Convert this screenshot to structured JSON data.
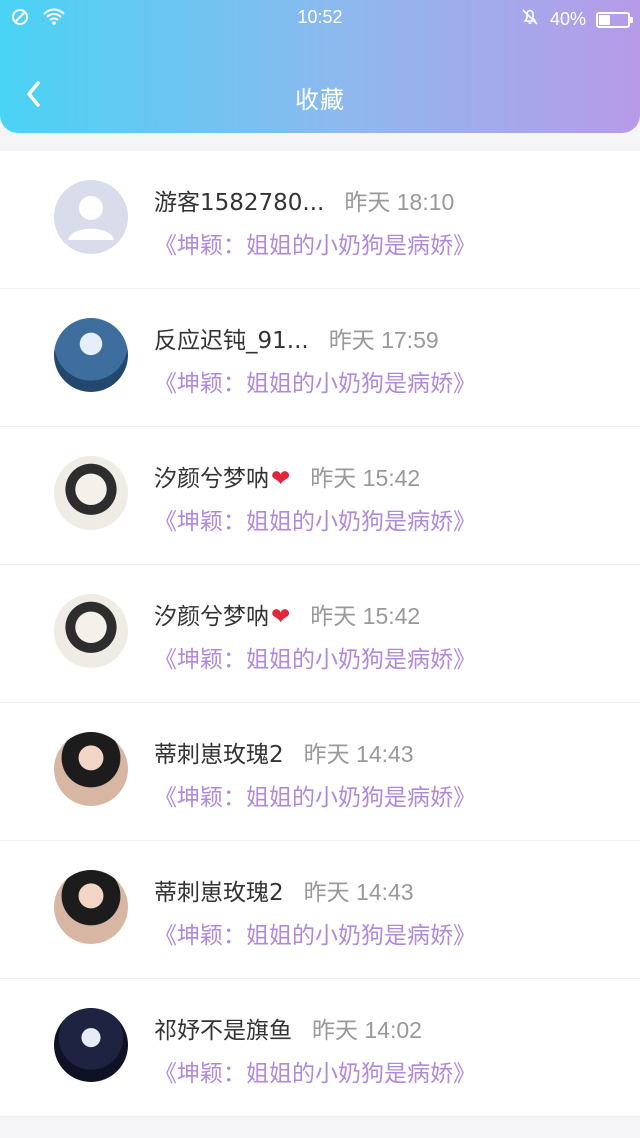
{
  "status_bar": {
    "time": "10:52",
    "battery_percent": "40%",
    "battery_level": 0.4
  },
  "header": {
    "title": "收藏",
    "back_icon": "chevron-left-icon"
  },
  "items": [
    {
      "username": "游客1582780...",
      "time": "昨天 18:10",
      "book_title": "《坤颖：姐姐的小奶狗是病娇》",
      "has_heart": false
    },
    {
      "username": "反应迟钝_91...",
      "time": "昨天 17:59",
      "book_title": "《坤颖：姐姐的小奶狗是病娇》",
      "has_heart": false
    },
    {
      "username": "汐颜兮梦呐",
      "time": "昨天 15:42",
      "book_title": "《坤颖：姐姐的小奶狗是病娇》",
      "has_heart": true
    },
    {
      "username": "汐颜兮梦呐",
      "time": "昨天 15:42",
      "book_title": "《坤颖：姐姐的小奶狗是病娇》",
      "has_heart": true
    },
    {
      "username": "蒂刺崽玫瑰2",
      "time": "昨天 14:43",
      "book_title": "《坤颖：姐姐的小奶狗是病娇》",
      "has_heart": false
    },
    {
      "username": "蒂刺崽玫瑰2",
      "time": "昨天 14:43",
      "book_title": "《坤颖：姐姐的小奶狗是病娇》",
      "has_heart": false
    },
    {
      "username": "祁妤不是旗鱼",
      "time": "昨天 14:02",
      "book_title": "《坤颖：姐姐的小奶狗是病娇》",
      "has_heart": false
    }
  ],
  "colors": {
    "header_start": "#49d3f4",
    "header_end": "#b79be8",
    "book_title": "#b08ad9",
    "timestamp": "#999999"
  }
}
